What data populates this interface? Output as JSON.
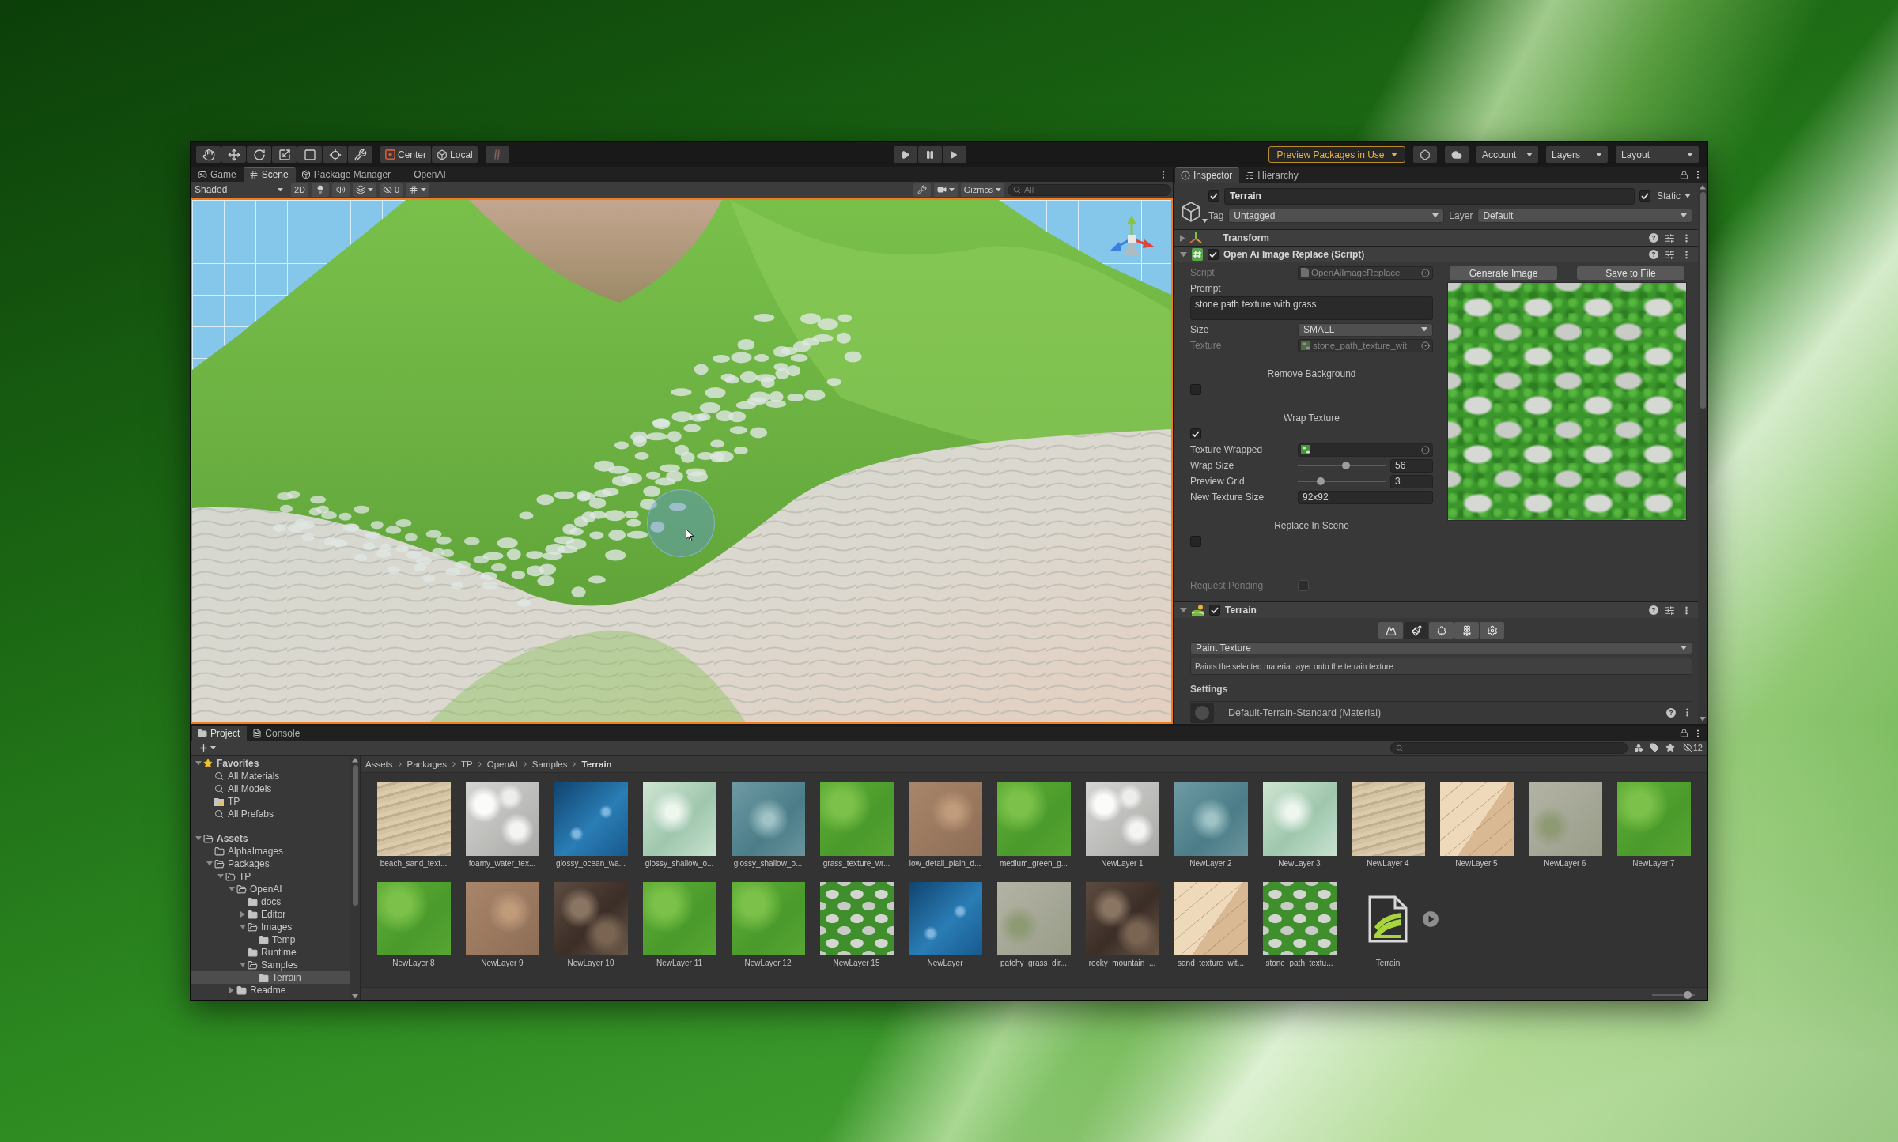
{
  "toolbar": {
    "tools": [
      {
        "kind": "hand",
        "selected": false
      },
      {
        "kind": "move",
        "selected": false
      },
      {
        "kind": "rotate",
        "selected": false
      },
      {
        "kind": "scale",
        "selected": false
      },
      {
        "kind": "rect",
        "selected": false
      },
      {
        "kind": "transform",
        "selected": false
      },
      {
        "kind": "custom",
        "selected": false
      }
    ],
    "handle_buttons": [
      {
        "kind": "pivot",
        "label": "Center"
      },
      {
        "kind": "space",
        "label": "Local"
      }
    ],
    "preview_packages": "Preview Packages in Use",
    "menus": [
      "Account",
      "Layers",
      "Layout"
    ]
  },
  "scene_panel": {
    "tabs": [
      {
        "kind": "game",
        "label": "Game",
        "selected": false
      },
      {
        "kind": "scene",
        "label": "Scene",
        "selected": true
      },
      {
        "kind": "package",
        "label": "Package Manager",
        "selected": false
      },
      {
        "kind": "plain",
        "label": "OpenAI",
        "selected": false
      }
    ],
    "shading": "Shaded",
    "view_2d": "2D",
    "hidden_count": "0",
    "gizmos": "Gizmos",
    "search": {
      "placeholder": "All"
    }
  },
  "inspector": {
    "tabs": [
      {
        "kind": "info",
        "label": "Inspector",
        "selected": true
      },
      {
        "kind": "hierarchy",
        "label": "Hierarchy",
        "selected": false
      }
    ],
    "object": {
      "active": true,
      "name": "Terrain",
      "static": true,
      "static_label": "Static",
      "tag_label": "Tag",
      "tag": "Untagged",
      "layer_label": "Layer",
      "layer": "Default"
    },
    "components": [
      {
        "kind": "transform",
        "title": "Transform",
        "expanded": false
      },
      {
        "kind": "script",
        "title": "Open Ai Image Replace (Script)",
        "expanded": true,
        "enabled": true,
        "buttons": [
          "Generate Image",
          "Save to File"
        ],
        "fields": [
          {
            "kind": "script-ref",
            "label": "Script",
            "value": "OpenAiImageReplace",
            "disabled": true
          },
          {
            "kind": "textarea",
            "label": "Prompt",
            "value": "stone path texture with grass"
          },
          {
            "kind": "dropdown",
            "label": "Size",
            "value": "SMALL"
          },
          {
            "kind": "texture-ref",
            "label": "Texture",
            "value": "stone_path_texture_wit",
            "disabled": true
          },
          {
            "kind": "toggle-heading",
            "label": "Remove Background",
            "checked": false
          },
          {
            "kind": "toggle-heading",
            "label": "Wrap Texture",
            "checked": true
          },
          {
            "kind": "texture-ref",
            "label": "Texture Wrapped",
            "disabled": false
          },
          {
            "kind": "slider",
            "label": "Wrap Size",
            "level": 0.55,
            "value": "56"
          },
          {
            "kind": "slider",
            "label": "Preview Grid",
            "level": 0.24,
            "value": "3"
          },
          {
            "kind": "text",
            "label": "New Texture Size",
            "value": "92x92"
          },
          {
            "kind": "toggle-heading",
            "label": "Replace In Scene",
            "checked": false
          },
          {
            "kind": "toggle",
            "label": "Request Pending",
            "checked": false,
            "disabled": true
          }
        ]
      },
      {
        "kind": "terrain",
        "title": "Terrain",
        "expanded": true,
        "enabled": true,
        "tools": [
          {
            "kind": "raise",
            "selected": false
          },
          {
            "kind": "paint",
            "selected": true
          },
          {
            "kind": "trees",
            "selected": false
          },
          {
            "kind": "details",
            "selected": false
          },
          {
            "kind": "settings",
            "selected": false
          }
        ],
        "mode": "Paint Texture",
        "help": "Paints the selected material layer onto the terrain texture",
        "section": "Settings",
        "material": "Default-Terrain-Standard (Material)"
      }
    ]
  },
  "project": {
    "tabs": [
      {
        "kind": "folder",
        "label": "Project",
        "selected": true
      },
      {
        "kind": "console",
        "label": "Console",
        "selected": false
      }
    ],
    "hidden_packages_count": "12",
    "tree": [
      {
        "label": "Favorites",
        "kind": "star",
        "expanded": true,
        "selected": false,
        "children": [
          {
            "label": "All Materials",
            "kind": "search",
            "selected": false
          },
          {
            "label": "All Models",
            "kind": "search",
            "selected": false
          },
          {
            "label": "TP",
            "kind": "favorite-folder",
            "selected": false
          },
          {
            "label": "All Prefabs",
            "kind": "search",
            "selected": false
          }
        ]
      },
      {
        "label": "Assets",
        "kind": "folder",
        "expanded": true,
        "selected": false,
        "children": [
          {
            "label": "AlphaImages",
            "kind": "empty-folder",
            "selected": false
          },
          {
            "label": "Packages",
            "kind": "folder",
            "expanded": true,
            "selected": false,
            "children": [
              {
                "label": "TP",
                "kind": "folder",
                "expanded": true,
                "selected": false,
                "children": [
                  {
                    "label": "OpenAI",
                    "kind": "folder",
                    "expanded": true,
                    "selected": false,
                    "children": [
                      {
                        "label": "docs",
                        "kind": "folder",
                        "selected": false
                      },
                      {
                        "label": "Editor",
                        "kind": "folder",
                        "expanded": false,
                        "selected": false
                      },
                      {
                        "label": "Images",
                        "kind": "folder",
                        "expanded": true,
                        "selected": false,
                        "children": [
                          {
                            "label": "Temp",
                            "kind": "folder",
                            "selected": false
                          }
                        ]
                      },
                      {
                        "label": "Runtime",
                        "kind": "folder",
                        "selected": false
                      },
                      {
                        "label": "Samples",
                        "kind": "folder",
                        "expanded": true,
                        "selected": false,
                        "children": [
                          {
                            "label": "Terrain",
                            "kind": "folder",
                            "selected": true
                          }
                        ]
                      }
                    ]
                  },
                  {
                    "label": "Readme",
                    "kind": "folder",
                    "expanded": false,
                    "selected": false
                  }
                ]
              }
            ]
          }
        ]
      }
    ],
    "breadcrumb": [
      "Assets",
      "Packages",
      "TP",
      "OpenAI",
      "Samples",
      "Terrain"
    ],
    "assets": [
      {
        "name": "beach_sand_text...",
        "kind": "sand"
      },
      {
        "name": "foamy_water_tex...",
        "kind": "foam"
      },
      {
        "name": "glossy_ocean_wa...",
        "kind": "ocean"
      },
      {
        "name": "glossy_shallow_o...",
        "kind": "shallow"
      },
      {
        "name": "glossy_shallow_o...",
        "kind": "lagoon"
      },
      {
        "name": "grass_texture_wr...",
        "kind": "grass"
      },
      {
        "name": "low_detail_plain_d...",
        "kind": "dirt"
      },
      {
        "name": "medium_green_g...",
        "kind": "grass"
      },
      {
        "name": "NewLayer 1",
        "kind": "foam"
      },
      {
        "name": "NewLayer 2",
        "kind": "lagoon"
      },
      {
        "name": "NewLayer 3",
        "kind": "shallow"
      },
      {
        "name": "NewLayer 4",
        "kind": "sand"
      },
      {
        "name": "NewLayer 5",
        "kind": "dune"
      },
      {
        "name": "NewLayer 6",
        "kind": "patchy"
      },
      {
        "name": "NewLayer 7",
        "kind": "grass"
      },
      {
        "name": "NewLayer 8",
        "kind": "grass"
      },
      {
        "name": "NewLayer 9",
        "kind": "dirt"
      },
      {
        "name": "NewLayer 10",
        "kind": "rock"
      },
      {
        "name": "NewLayer 11",
        "kind": "grass"
      },
      {
        "name": "NewLayer 12",
        "kind": "grass"
      },
      {
        "name": "NewLayer 15",
        "kind": "stone"
      },
      {
        "name": "NewLayer",
        "kind": "ocean"
      },
      {
        "name": "patchy_grass_dir...",
        "kind": "patchy"
      },
      {
        "name": "rocky_mountain_...",
        "kind": "rock"
      },
      {
        "name": "sand_texture_wit...",
        "kind": "dune"
      },
      {
        "name": "stone_path_textu...",
        "kind": "stone"
      },
      {
        "name": "Terrain",
        "kind": "terrain"
      }
    ],
    "icon_size": {
      "level": 0.9
    }
  }
}
